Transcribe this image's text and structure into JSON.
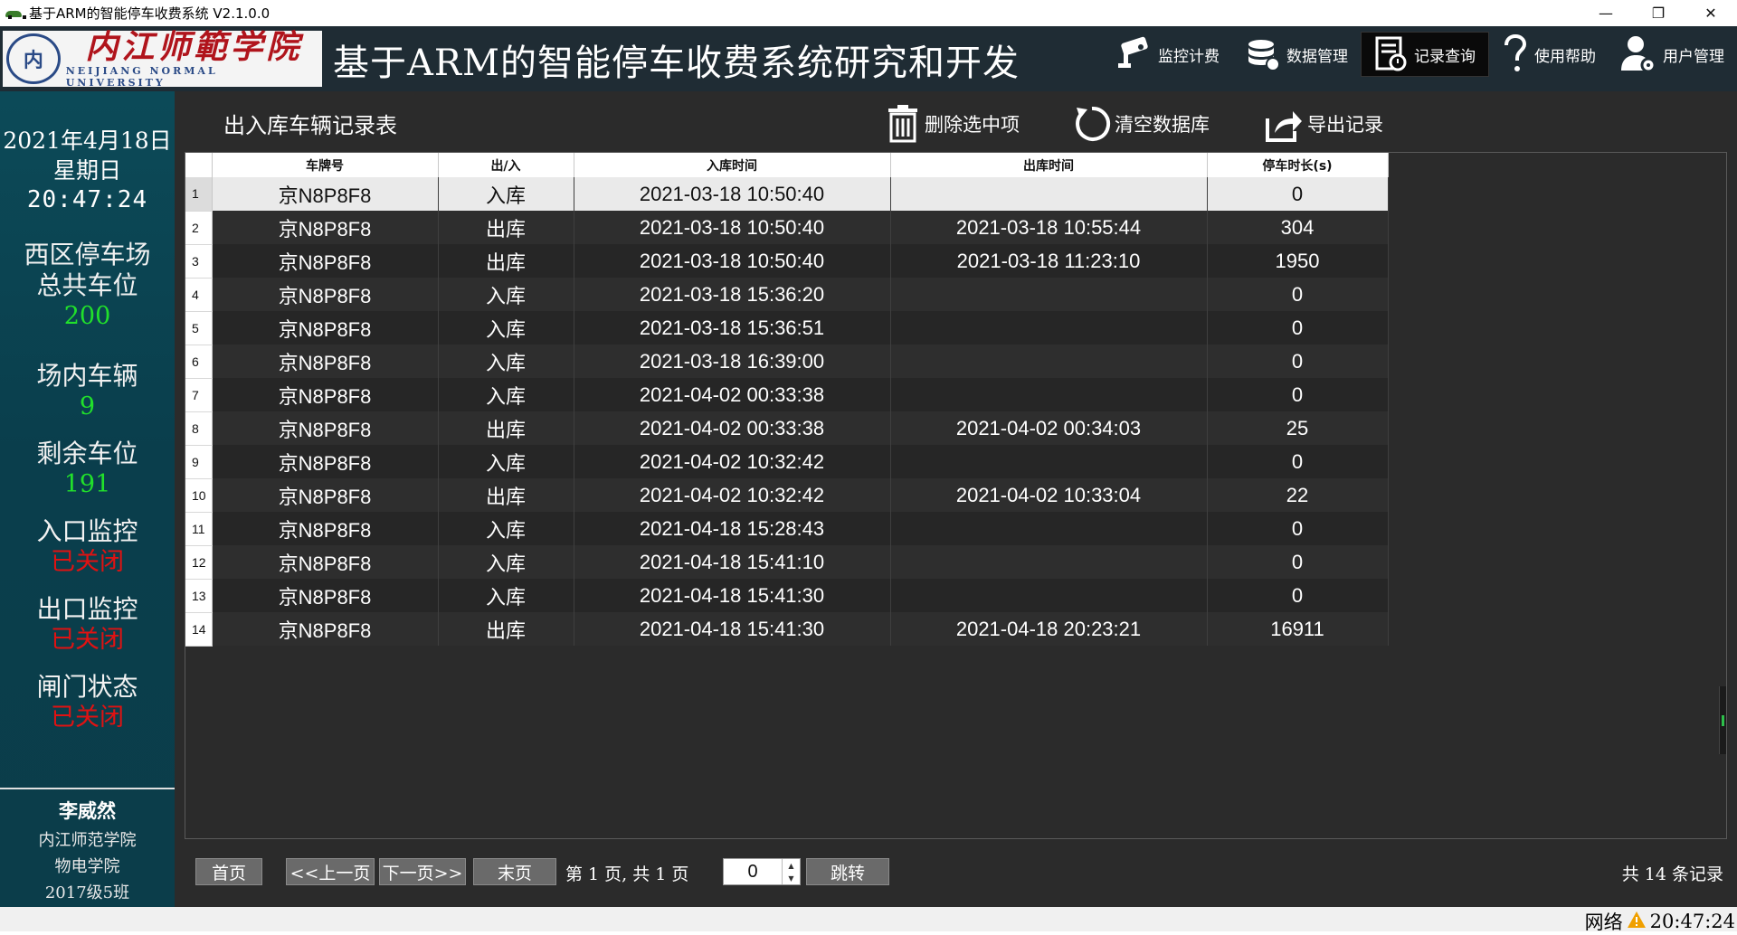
{
  "window": {
    "title": "基于ARM的智能停车收费系统 V2.1.0.0",
    "minimize": "—",
    "maximize": "❐",
    "close": "✕"
  },
  "header": {
    "logo": {
      "seal_text": "内",
      "school_cn": "内江师範学院",
      "school_en": "NEIJIANG NORMAL UNIVERSITY"
    },
    "app_title": "基于ARM的智能停车收费系统研究和开发",
    "nav": [
      {
        "label": "监控计费",
        "icon": "camera-icon"
      },
      {
        "label": "数据管理",
        "icon": "database-icon"
      },
      {
        "label": "记录查询",
        "icon": "record-query-icon",
        "active": true
      },
      {
        "label": "使用帮助",
        "icon": "question-icon"
      },
      {
        "label": "用户管理",
        "icon": "user-gear-icon"
      }
    ]
  },
  "sidebar": {
    "date": "2021年4月18日",
    "weekday": "星期日",
    "time": "20:47:24",
    "lot_name": "西区停车场",
    "total_label": "总共车位",
    "total_value": "200",
    "in_lot_label": "场内车辆",
    "in_lot_value": "9",
    "remaining_label": "剩余车位",
    "remaining_value": "191",
    "entrance_label": "入口监控",
    "entrance_status": "已关闭",
    "exit_label": "出口监控",
    "exit_status": "已关闭",
    "gate_label": "闸门状态",
    "gate_status": "已关闭",
    "user": {
      "name": "李威然",
      "school": "内江师范学院",
      "college": "物电学院",
      "class": "2017级5班"
    }
  },
  "main": {
    "title": "出入库车辆记录表",
    "toolbar": {
      "delete": "删除选中项",
      "clear": "清空数据库",
      "export": "导出记录"
    },
    "table": {
      "columns": [
        "车牌号",
        "出/入",
        "入库时间",
        "出库时间",
        "停车时长(s)"
      ],
      "rows": [
        {
          "n": "1",
          "plate": "京N8P8F8",
          "dir": "入库",
          "in": "2021-03-18 10:50:40",
          "out": "",
          "dur": "0"
        },
        {
          "n": "2",
          "plate": "京N8P8F8",
          "dir": "出库",
          "in": "2021-03-18 10:50:40",
          "out": "2021-03-18 10:55:44",
          "dur": "304"
        },
        {
          "n": "3",
          "plate": "京N8P8F8",
          "dir": "出库",
          "in": "2021-03-18 10:50:40",
          "out": "2021-03-18 11:23:10",
          "dur": "1950"
        },
        {
          "n": "4",
          "plate": "京N8P8F8",
          "dir": "入库",
          "in": "2021-03-18 15:36:20",
          "out": "",
          "dur": "0"
        },
        {
          "n": "5",
          "plate": "京N8P8F8",
          "dir": "入库",
          "in": "2021-03-18 15:36:51",
          "out": "",
          "dur": "0"
        },
        {
          "n": "6",
          "plate": "京N8P8F8",
          "dir": "入库",
          "in": "2021-03-18 16:39:00",
          "out": "",
          "dur": "0"
        },
        {
          "n": "7",
          "plate": "京N8P8F8",
          "dir": "入库",
          "in": "2021-04-02 00:33:38",
          "out": "",
          "dur": "0"
        },
        {
          "n": "8",
          "plate": "京N8P8F8",
          "dir": "出库",
          "in": "2021-04-02 00:33:38",
          "out": "2021-04-02 00:34:03",
          "dur": "25"
        },
        {
          "n": "9",
          "plate": "京N8P8F8",
          "dir": "入库",
          "in": "2021-04-02 10:32:42",
          "out": "",
          "dur": "0"
        },
        {
          "n": "10",
          "plate": "京N8P8F8",
          "dir": "出库",
          "in": "2021-04-02 10:32:42",
          "out": "2021-04-02 10:33:04",
          "dur": "22"
        },
        {
          "n": "11",
          "plate": "京N8P8F8",
          "dir": "入库",
          "in": "2021-04-18 15:28:43",
          "out": "",
          "dur": "0"
        },
        {
          "n": "12",
          "plate": "京N8P8F8",
          "dir": "入库",
          "in": "2021-04-18 15:41:10",
          "out": "",
          "dur": "0"
        },
        {
          "n": "13",
          "plate": "京N8P8F8",
          "dir": "入库",
          "in": "2021-04-18 15:41:30",
          "out": "",
          "dur": "0"
        },
        {
          "n": "14",
          "plate": "京N8P8F8",
          "dir": "出库",
          "in": "2021-04-18 15:41:30",
          "out": "2021-04-18 20:23:21",
          "dur": "16911"
        }
      ],
      "selected_row": "1"
    },
    "pager": {
      "first": "首页",
      "prev": "<<上一页",
      "next": "下一页>>",
      "last": "末页",
      "page_info": "第 1 页, 共 1 页",
      "jump_value": "0",
      "jump": "跳转",
      "total": "共 14 条记录"
    }
  },
  "statusbar": {
    "network": "网络",
    "time": "20:47:24"
  },
  "colors": {
    "header_bg": "#1f2c34",
    "sidebar_bg": "#0b4452",
    "main_bg": "#2b2b2b",
    "green_value": "#21e02b",
    "red_status": "#e01212",
    "school_red": "#b0141c"
  }
}
